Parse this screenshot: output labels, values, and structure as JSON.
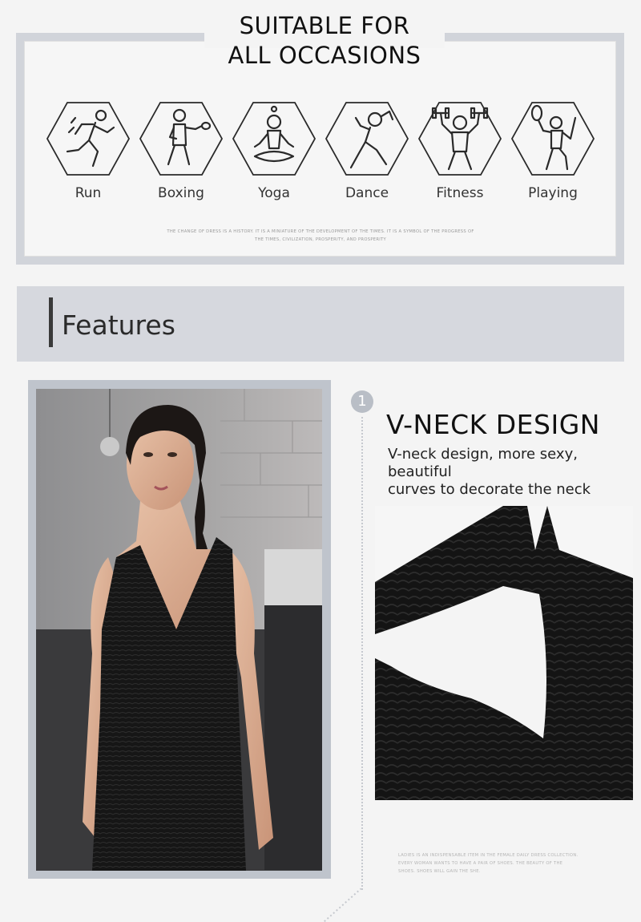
{
  "occasions": {
    "title_line1": "SUITABLE FOR",
    "title_line2": "ALL OCCASIONS",
    "items": [
      {
        "label": "Run",
        "icon": "running-icon"
      },
      {
        "label": "Boxing",
        "icon": "boxing-icon"
      },
      {
        "label": "Yoga",
        "icon": "yoga-icon"
      },
      {
        "label": "Dance",
        "icon": "dance-icon"
      },
      {
        "label": "Fitness",
        "icon": "fitness-icon"
      },
      {
        "label": "Playing",
        "icon": "badminton-icon"
      }
    ],
    "fine_print_line1": "THE CHANGE OF DRESS IS A HISTORY. IT IS A MINIATURE OF THE DEVELOPMENT OF THE TIMES. IT IS A SYMBOL OF THE PROGRESS OF",
    "fine_print_line2": "THE TIMES, CIVILIZATION, PROSPERITY, AND PROSPERITY"
  },
  "features": {
    "heading": "Features"
  },
  "feature_1": {
    "number": "1",
    "title": "V-NECK DESIGN",
    "desc_line1": "V-neck design, more sexy, beautiful",
    "desc_line2": "curves to decorate the neck",
    "fine_print_line1": "LADIES IS AN INDISPENSABLE ITEM IN THE FEMALE DAILY DRESS COLLECTION.",
    "fine_print_line2": "EVERY WOMAN WANTS TO HAVE A PAIR OF SHOES. THE BEAUTY OF THE",
    "fine_print_line3": "SHOES. SHOES WILL GAIN THE SHE."
  }
}
